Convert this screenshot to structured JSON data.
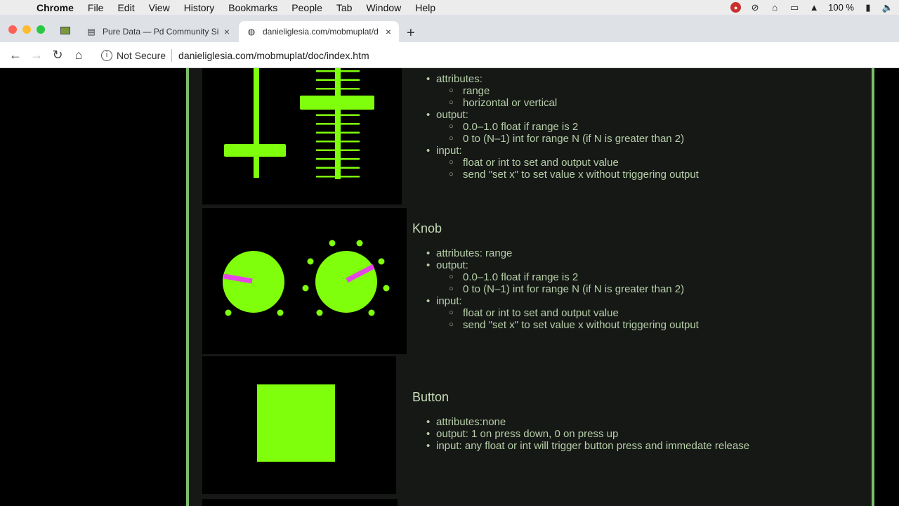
{
  "menubar": {
    "app_name": "Chrome",
    "items": [
      "File",
      "Edit",
      "View",
      "History",
      "Bookmarks",
      "People",
      "Tab",
      "Window",
      "Help"
    ],
    "battery": "100 %"
  },
  "tabs": [
    {
      "title": "Pure Data — Pd Community Si",
      "active": false
    },
    {
      "title": "danieliglesia.com/mobmuplat/d",
      "active": true
    }
  ],
  "toolbar": {
    "security_label": "Not Secure",
    "url": "danieliglesia.com/mobmuplat/doc/index.htm"
  },
  "sections": {
    "slider": {
      "attributes_label": "attributes:",
      "attributes": [
        "range",
        "horizontal or vertical"
      ],
      "output_label": "output:",
      "output": [
        "0.0–1.0 float if range is 2",
        "0 to (N–1) int for range N (if N is greater than 2)"
      ],
      "input_label": "input:",
      "input": [
        "float or int to set and output value",
        "send \"set x\" to set value x without triggering output"
      ]
    },
    "knob": {
      "title": "Knob",
      "attributes": "attributes: range",
      "output_label": "output:",
      "output": [
        "0.0–1.0 float if range is 2",
        "0 to (N–1) int for range N (if N is greater than 2)"
      ],
      "input_label": "input:",
      "input": [
        "float or int to set and output value",
        "send \"set x\" to set value x without triggering output"
      ]
    },
    "button": {
      "title": "Button",
      "items": [
        "attributes:none",
        "output: 1 on press down, 0 on press up",
        "input: any float or int will trigger button press and immedate release"
      ]
    }
  },
  "colors": {
    "widget_green": "#80ff0d",
    "knob_indicator": "#e645e6",
    "page_border": "#7bbf6a",
    "doc_text": "#b6cfa8"
  }
}
